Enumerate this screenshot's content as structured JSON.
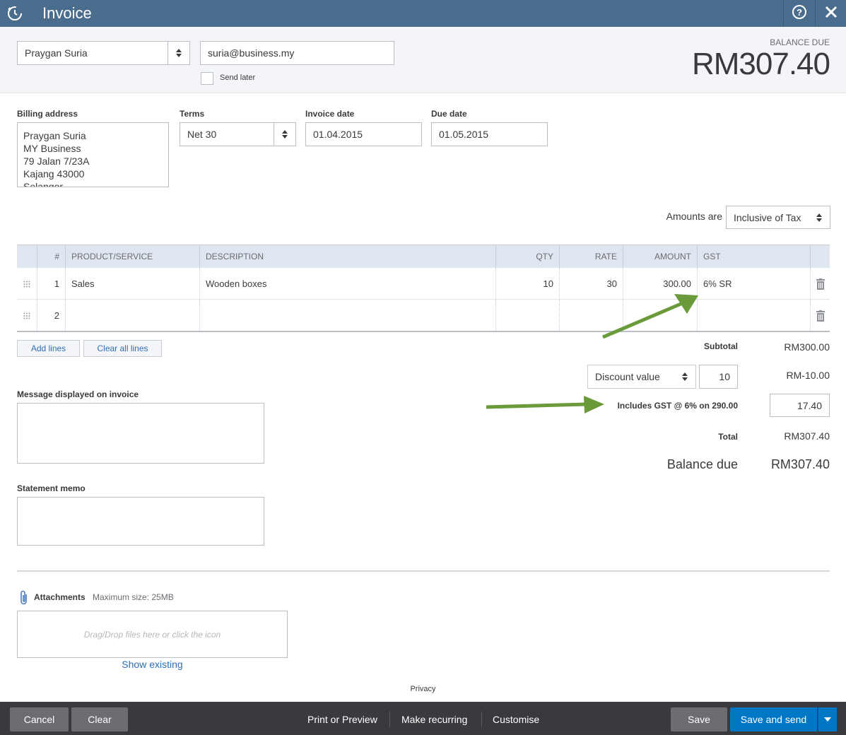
{
  "header": {
    "title": "Invoice",
    "help_label": "?",
    "close_label": "✕"
  },
  "customer": {
    "name": "Praygan Suria",
    "email": "suria@business.my",
    "send_later_label": "Send later"
  },
  "balance": {
    "label": "BALANCE DUE",
    "amount": "RM307.40"
  },
  "billing": {
    "label": "Billing address",
    "lines": [
      "Praygan Suria",
      "MY Business",
      "79 Jalan 7/23A",
      "Kajang 43000",
      "Selangor"
    ]
  },
  "terms": {
    "label": "Terms",
    "value": "Net 30"
  },
  "invoice_date": {
    "label": "Invoice date",
    "value": "01.04.2015"
  },
  "due_date": {
    "label": "Due date",
    "value": "01.05.2015"
  },
  "amounts_are": {
    "label": "Amounts are",
    "value": "Inclusive of Tax"
  },
  "table": {
    "headers": {
      "num": "#",
      "product": "PRODUCT/SERVICE",
      "description": "DESCRIPTION",
      "qty": "QTY",
      "rate": "RATE",
      "amount": "AMOUNT",
      "gst": "GST"
    },
    "rows": [
      {
        "num": "1",
        "product": "Sales",
        "description": "Wooden boxes",
        "qty": "10",
        "rate": "30",
        "amount": "300.00",
        "gst": "6% SR"
      },
      {
        "num": "2",
        "product": "",
        "description": "",
        "qty": "",
        "rate": "",
        "amount": "",
        "gst": ""
      }
    ]
  },
  "line_buttons": {
    "add": "Add lines",
    "clear": "Clear all lines"
  },
  "totals": {
    "subtotal_label": "Subtotal",
    "subtotal": "RM300.00",
    "discount_type": "Discount value",
    "discount_input": "10",
    "discount_amount": "RM-10.00",
    "gst_label": "Includes GST @ 6% on 290.00",
    "gst_value": "17.40",
    "total_label": "Total",
    "total": "RM307.40",
    "balance_label": "Balance due",
    "balance": "RM307.40"
  },
  "message": {
    "label": "Message displayed on invoice"
  },
  "memo": {
    "label": "Statement memo"
  },
  "attachments": {
    "label": "Attachments",
    "max": "Maximum size: 25MB",
    "drop_hint": "Drag/Drop files here or click the icon",
    "show_existing": "Show existing"
  },
  "privacy": "Privacy",
  "footer": {
    "cancel": "Cancel",
    "clear": "Clear",
    "print": "Print or Preview",
    "recurring": "Make recurring",
    "customise": "Customise",
    "save": "Save",
    "save_send": "Save and send"
  },
  "colors": {
    "header": "#4a6d8e",
    "footer": "#393a3d",
    "primary_button": "#0077c5",
    "link": "#2d6fb6",
    "annotation_arrow": "#6a9a3a"
  }
}
